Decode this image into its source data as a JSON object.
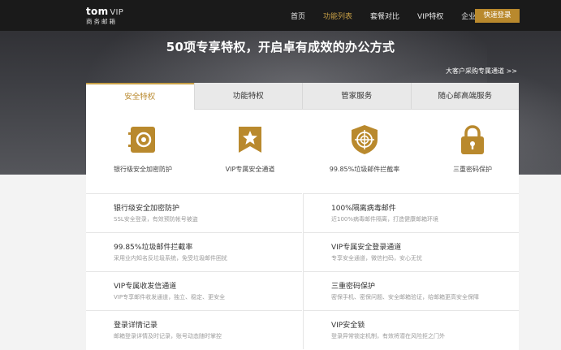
{
  "nav": {
    "logo_main": "tom",
    "logo_vip": "VIP",
    "logo_sub": "商务邮箱",
    "links": [
      "首页",
      "功能列表",
      "套餐对比",
      "VIP特权",
      "企业采购"
    ],
    "login": "快速登录"
  },
  "hero": {
    "headline": "50项专享特权，开启卓有成效的办公方式",
    "corp_link": "大客户采购专属通道 >>"
  },
  "tabs": [
    "安全特权",
    "功能特权",
    "管家服务",
    "随心邮高端服务"
  ],
  "features": [
    {
      "label": "银行级安全加密防护",
      "icon": "safe-icon"
    },
    {
      "label": "VIP专属安全通道",
      "icon": "star-ribbon-icon"
    },
    {
      "label": "99.85%垃圾邮件拦截率",
      "icon": "shield-target-icon"
    },
    {
      "label": "三重密码保护",
      "icon": "lock-icon"
    }
  ],
  "items": [
    {
      "title": "银行级安全加密防护",
      "desc": "SSL安全登录，有效预防帐号被盗"
    },
    {
      "title": "100%隔离病毒邮件",
      "desc": "近100%病毒邮件隔离，打造健康邮箱环境"
    },
    {
      "title": "99.85%垃圾邮件拦截率",
      "desc": "采用业内知名反垃圾系统，免受垃圾邮件困扰"
    },
    {
      "title": "VIP专属安全登录通道",
      "desc": "专享安全通道，微信扫码，安心无忧"
    },
    {
      "title": "VIP专属收发信通道",
      "desc": "VIP专享邮件收发通道，独立、稳定、更安全"
    },
    {
      "title": "三重密码保护",
      "desc": "密保手机、密保问题、安全邮箱验证，给邮箱更高安全保障"
    },
    {
      "title": "登录详情记录",
      "desc": "邮箱登录详情及时记录，账号动态随时掌控"
    },
    {
      "title": "VIP安全锁",
      "desc": "登录异常锁定机制，有效将潜在风险拒之门外"
    }
  ],
  "colors": {
    "accent": "#c8a046",
    "icon_gold": "#b9892d",
    "nav_bg": "#1a1a1a"
  }
}
